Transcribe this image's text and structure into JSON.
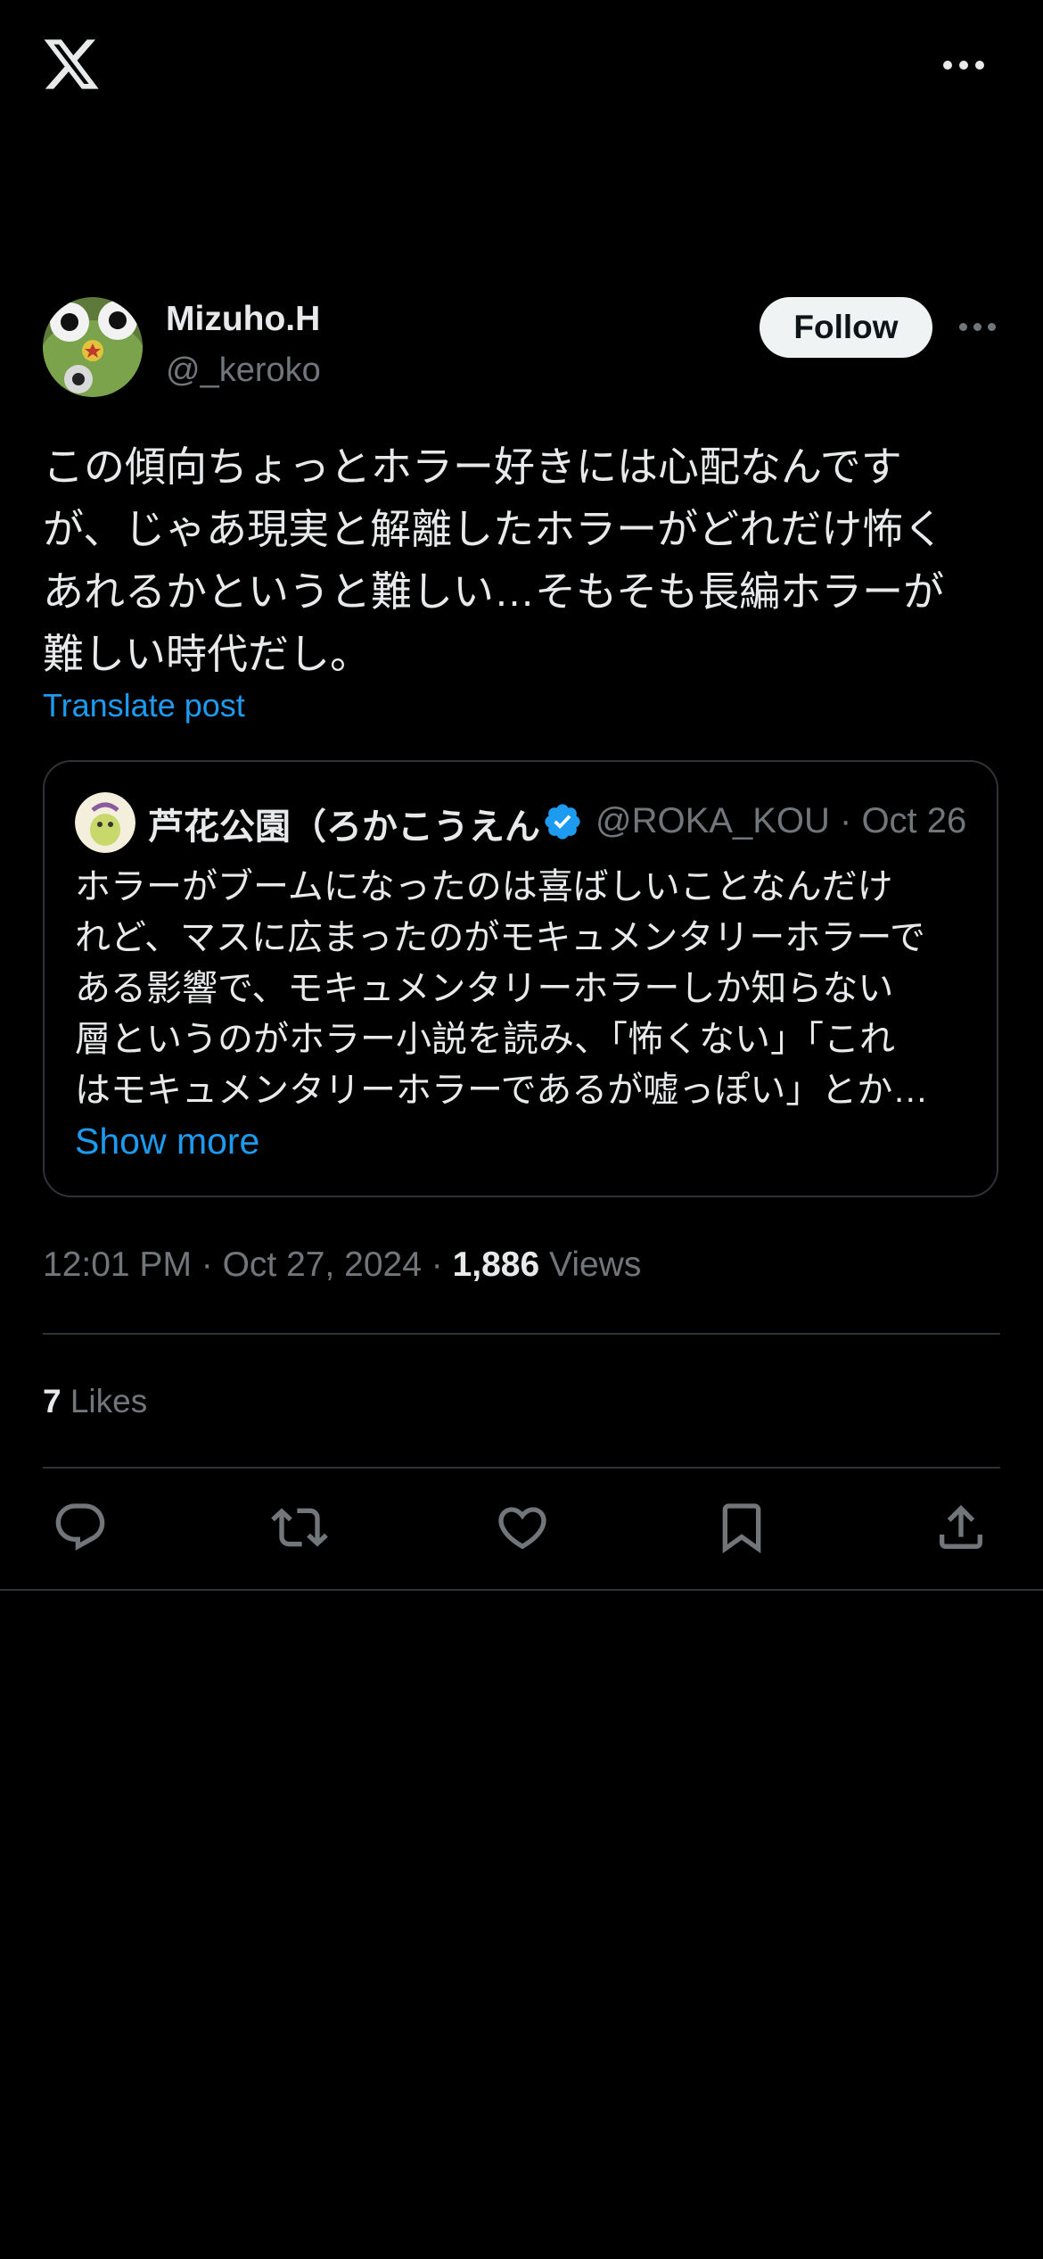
{
  "topbar": {
    "logo_icon": "x-logo-icon",
    "more_icon": "more-horizontal-icon"
  },
  "post": {
    "author_name": "Mizuho.H",
    "author_handle": "@_keroko",
    "follow_label": "Follow",
    "text": "この傾向ちょっとホラー好きには心配なんです\nが、じゃあ現実と解離したホラーがどれだけ怖く\nあれるかというと難しい…そもそも長編ホラーが\n難しい時代だし。",
    "translate_label": "Translate post"
  },
  "quote": {
    "author_name": "芦花公園（ろかこうえん",
    "handle_date": "@ROKA_KOU · Oct 26",
    "text": "ホラーがブームになったのは喜ばしいことなんだけ\nれど、マスに広まったのがモキュメンタリーホラーで\nある影響で、モキュメンタリーホラーしか知らない\n層というのがホラー小説を読み、「怖くない」「これ\nはモキュメンタリーホラーであるが嘘っぽい」とか…",
    "show_more_label": "Show more",
    "verified_color": "#1d9bf0"
  },
  "meta": {
    "time_date": "12:01 PM · Oct 27, 2024 · ",
    "views_count": "1,886",
    "views_label": " Views"
  },
  "likes": {
    "count": "7",
    "label": " Likes"
  },
  "actions": [
    "reply-icon",
    "repost-icon",
    "like-icon",
    "bookmark-icon",
    "share-icon"
  ],
  "colors": {
    "accent": "#1d9bf0",
    "background": "#000000",
    "muted": "#71767b"
  }
}
